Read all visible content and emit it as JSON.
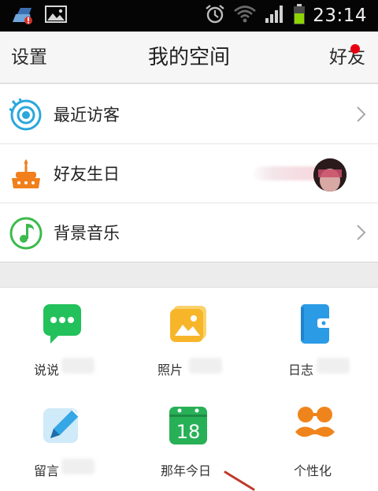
{
  "status_bar": {
    "time": "23:14",
    "icons": [
      "app-notification-icon",
      "gallery-icon",
      "alarm-icon",
      "wifi-icon",
      "signal-icon",
      "battery-icon"
    ],
    "battery_color": "#8ed400"
  },
  "header": {
    "left": "设置",
    "title": "我的空间",
    "right": "好友",
    "badge_color": "#e60012"
  },
  "list": [
    {
      "label": "最近访客",
      "icon": "eye-icon",
      "color": "#2aa7dd"
    },
    {
      "label": "好友生日",
      "icon": "birthday-cake-icon",
      "color": "#f07f1c"
    },
    {
      "label": "背景音乐",
      "icon": "music-note-icon",
      "color": "#3cbb4c"
    }
  ],
  "grid": [
    {
      "label": "说说",
      "icon": "chat-bubble-icon",
      "color": "#23c15b"
    },
    {
      "label": "照片",
      "icon": "photo-icon",
      "color": "#f7b52a"
    },
    {
      "label": "日志",
      "icon": "journal-icon",
      "color": "#2b9be6"
    },
    {
      "label": "留言",
      "icon": "pen-icon",
      "color": "#35a6e6"
    },
    {
      "label": "那年今日",
      "icon": "calendar-icon",
      "color": "#28b057",
      "day": "18"
    },
    {
      "label": "个性化",
      "icon": "mustache-glasses-icon",
      "color": "#f0841c"
    }
  ]
}
